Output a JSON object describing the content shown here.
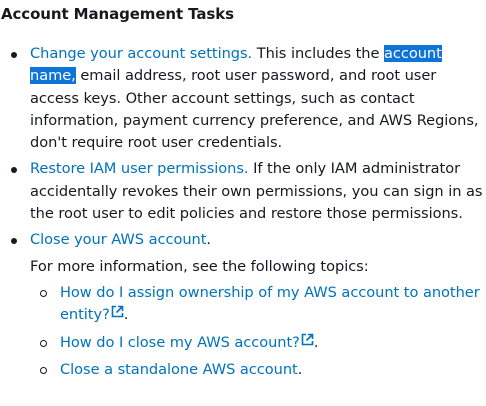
{
  "heading": "Account Management Tasks",
  "tasks": [
    {
      "link": "Change your account settings.",
      "text_before_highlight": " This includes the ",
      "highlight": "account name,",
      "text_after_highlight": " email address, root user password, and root user access keys. Other account settings, such as contact information, payment currency preference, and AWS Regions, don't require root user credentials."
    },
    {
      "link": "Restore IAM user permissions.",
      "text": " If the only IAM administrator accidentally revokes their own permissions, you can sign in as the root user to edit policies and restore those permissions."
    },
    {
      "link": "Close your AWS account",
      "text": ".",
      "more_info": "For more information, see the following topics:",
      "topics": [
        {
          "link": "How do I assign ownership of my AWS account to another entity?",
          "external": true,
          "suffix": "."
        },
        {
          "link": "How do I close my AWS account?",
          "external": true,
          "suffix": "."
        },
        {
          "link": "Close a standalone AWS account",
          "external": false,
          "suffix": "."
        }
      ]
    }
  ],
  "colors": {
    "link": "#0073bb",
    "text": "#16191f",
    "highlight_bg": "#0f74d9",
    "highlight_fg": "#ffffff"
  },
  "icons": {
    "external_link": "external-link-icon"
  }
}
